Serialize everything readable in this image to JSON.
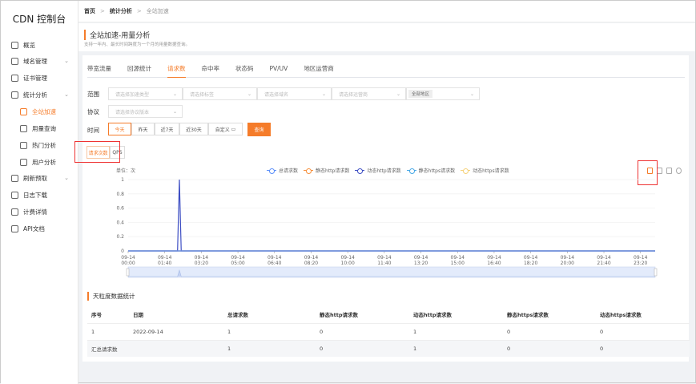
{
  "app_title": "CDN 控制台",
  "sidebar": {
    "items": [
      {
        "label": "概览",
        "icon": "overview-icon"
      },
      {
        "label": "域名管理",
        "icon": "globe-icon",
        "expandable": true
      },
      {
        "label": "证书管理",
        "icon": "certificate-icon"
      },
      {
        "label": "统计分析",
        "icon": "chart-icon",
        "expandable": true
      },
      {
        "label": "全站加速",
        "icon": "rocket-icon",
        "sub": true,
        "active": true
      },
      {
        "label": "用量查询",
        "icon": "document-icon",
        "sub": true
      },
      {
        "label": "热门分析",
        "icon": "user-icon",
        "sub": true
      },
      {
        "label": "用户分析",
        "icon": "user-icon",
        "sub": true
      },
      {
        "label": "刷新预取",
        "icon": "refresh-icon",
        "expandable": true
      },
      {
        "label": "日志下载",
        "icon": "log-icon"
      },
      {
        "label": "计费详情",
        "icon": "billing-icon"
      },
      {
        "label": "API文档",
        "icon": "api-doc-icon"
      }
    ]
  },
  "breadcrumb": [
    "首页",
    "统计分析",
    "全站加速"
  ],
  "header": {
    "title": "全站加速-用量分析",
    "description": "支持一年内、最长时间跨度为一个月的用量数据查询。"
  },
  "tabs": [
    "带宽流量",
    "回源统计",
    "请求数",
    "命中率",
    "状态码",
    "PV/UV",
    "地区运营商"
  ],
  "active_tab": 2,
  "filters": {
    "scope_label": "范围",
    "scope_selects": [
      "请选择加速类型",
      "请选择标签",
      "请选择域名",
      "请选择运营商"
    ],
    "region_tag": "全部地区",
    "protocol_label": "协议",
    "protocol_placeholder": "请选择协议版本",
    "time_label": "时间",
    "time_options": [
      "今天",
      "昨天",
      "近7天",
      "近30天",
      "自定义"
    ],
    "active_time": 0,
    "query_button": "查询"
  },
  "metric_buttons": [
    "请求次数",
    "QPS"
  ],
  "accent": "#f57c2a",
  "chart_data": {
    "type": "line",
    "unit_label": "单位：次",
    "x_tick_labels": [
      "09-14\n00:00",
      "09-14\n01:40",
      "09-14\n03:20",
      "09-14\n05:00",
      "09-14\n06:40",
      "09-14\n08:20",
      "09-14\n10:00",
      "09-14\n11:40",
      "09-14\n13:20",
      "09-14\n15:00",
      "09-14\n16:40",
      "09-14\n18:20",
      "09-14\n20:00",
      "09-14\n21:40",
      "09-14\n23:20"
    ],
    "x_unit": "minutes since 09-14 00:00",
    "xlim": [
      0,
      1440
    ],
    "ylim": [
      0,
      1
    ],
    "y_ticks": [
      "0",
      "0.2",
      "0.4",
      "0.6",
      "0.8",
      "1"
    ],
    "series": [
      {
        "name": "总请求数",
        "color": "#5b8ff9",
        "points": [
          [
            0,
            0
          ],
          [
            1440,
            0
          ]
        ]
      },
      {
        "name": "静态http请求数",
        "color": "#f6903d",
        "points": [
          [
            0,
            0
          ],
          [
            1440,
            0
          ]
        ]
      },
      {
        "name": "动态http请求数",
        "color": "#3d4ec3",
        "points": [
          [
            0,
            0
          ],
          [
            135,
            0
          ],
          [
            140,
            1
          ],
          [
            145,
            0
          ],
          [
            1440,
            0
          ]
        ]
      },
      {
        "name": "静态https请求数",
        "color": "#48a8e6",
        "points": [
          [
            0,
            0
          ],
          [
            1440,
            0
          ]
        ]
      },
      {
        "name": "动态https请求数",
        "color": "#f5d27a",
        "points": [
          [
            0,
            0
          ],
          [
            1440,
            0
          ]
        ]
      }
    ]
  },
  "table": {
    "title": "天粒度数据统计",
    "headers": [
      "序号",
      "日期",
      "总请求数",
      "静态http请求数",
      "动态http请求数",
      "静态https请求数",
      "动态https请求数"
    ],
    "rows": [
      [
        "1",
        "2022-09-14",
        "1",
        "0",
        "1",
        "0",
        "0"
      ]
    ],
    "summary": [
      "汇总请求数",
      "",
      "1",
      "0",
      "1",
      "0",
      "0"
    ]
  }
}
